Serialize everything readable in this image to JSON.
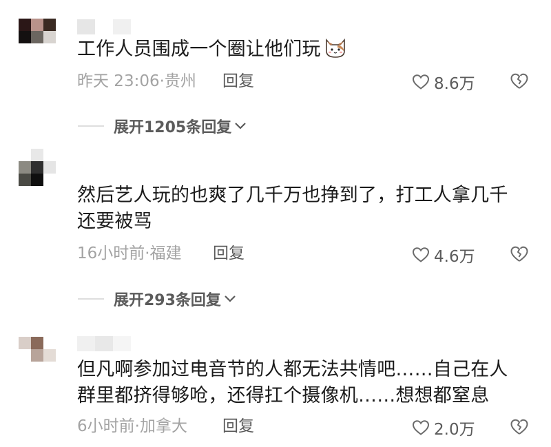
{
  "colors": {
    "text": "#1b1b1b",
    "meta": "#a3a3a3",
    "secondary": "#5b5b5b",
    "divider": "#dedede"
  },
  "comments": [
    {
      "text": "工作人员围成一个圈让他们玩",
      "emoji": "cat-face-emoji",
      "time_location": "昨天 23:06·贵州",
      "reply_label": "回复",
      "likes": "8.6万",
      "expand_label": "展开1205条回复",
      "avatar_colors": [
        "#2b1717",
        "#b8928a",
        "#3a2a22",
        "#141010",
        "#6b6660",
        "#d8d4d0",
        "#ffffff",
        "#ffffff",
        "#ffffff"
      ],
      "username_colors": [
        "#e6e6e6",
        "#ffffff",
        "#f0f0f0"
      ]
    },
    {
      "text": "然后艺人玩的也爽了几千万也挣到了，打工人拿几千\n还要被骂",
      "time_location": "16小时前·福建",
      "reply_label": "回复",
      "likes": "4.6万",
      "expand_label": "展开293条回复",
      "avatar_colors": [
        "#ffffff",
        "#e8e8e8",
        "#ffffff",
        "#8c8a82",
        "#2f2f2f",
        "#e5e5e5",
        "#4a4a44",
        "#0f0f0f",
        "#ffffff"
      ],
      "username_colors": [
        "#ffffff",
        "#ffffff",
        "#ffffff"
      ]
    },
    {
      "text": "但凡啊参加过电音节的人都无法共情吧……自己在人\n群里都挤得够呛，还得扛个摄像机……想想都窒息",
      "time_location": "6小时前·加拿大",
      "reply_label": "回复",
      "likes": "2.0万",
      "avatar_colors": [
        "#d9cec8",
        "#8a6a5a",
        "#ffffff",
        "#ffffff",
        "#b8a49a",
        "#e4dcd6",
        "#ffffff",
        "#ffffff",
        "#ffffff"
      ],
      "username_colors": [
        "#f0f0f0",
        "#e8e8e8",
        "#f5f5f5"
      ]
    }
  ]
}
